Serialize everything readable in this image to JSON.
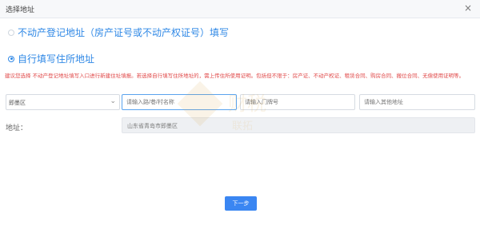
{
  "window": {
    "title": "选择地址",
    "close": "×"
  },
  "options": {
    "option1": "不动产登记地址（房产证号或不动产权证号）填写",
    "option2": "自行填写住所地址"
  },
  "notice": "建议您选择 不动产登记地址填写入口进行新建住址填报。若选择自行填写住所地址的，需上传住所使用证明。包括但不限于：房产证、不动产权证、租赁合同、购房合同、搬位合同、无偿使用证明等。",
  "form": {
    "district_value": "即墨区",
    "road_placeholder": "请输入路/巷/村名称",
    "door_placeholder": "请输入门牌号",
    "detail_placeholder": "请输入其他地址"
  },
  "address": {
    "label": "地址：",
    "value": "山东省青岛市即墨区"
  },
  "buttons": {
    "next": "下一步"
  },
  "watermark": {
    "text": "财税联拓"
  }
}
